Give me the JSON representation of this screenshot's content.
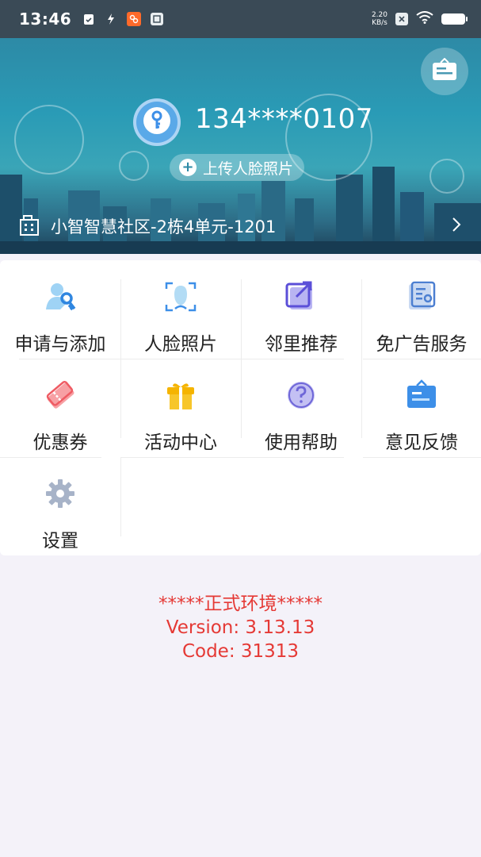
{
  "status_bar": {
    "time": "13:46",
    "net_speed_value": "2.20",
    "net_speed_unit": "KB/s"
  },
  "profile": {
    "phone": "134****0107",
    "upload_face_label": "上传人脸照片",
    "address": "小智智慧社区-2栋4单元-1201"
  },
  "menu": [
    {
      "label": "申请与添加",
      "icon": "key-person-icon"
    },
    {
      "label": "人脸照片",
      "icon": "face-scan-icon"
    },
    {
      "label": "邻里推荐",
      "icon": "share-icon"
    },
    {
      "label": "免广告服务",
      "icon": "certificate-icon"
    },
    {
      "label": "优惠券",
      "icon": "coupon-icon"
    },
    {
      "label": "活动中心",
      "icon": "gift-icon"
    },
    {
      "label": "使用帮助",
      "icon": "help-icon"
    },
    {
      "label": "意见反馈",
      "icon": "feedback-board-icon"
    },
    {
      "label": "设置",
      "icon": "gear-icon"
    }
  ],
  "env": {
    "environment": "*****正式环境*****",
    "version": "Version: 3.13.13",
    "code": "Code: 31313"
  },
  "colors": {
    "accent_blue": "#3d8fe8",
    "env_text": "#e53935"
  }
}
